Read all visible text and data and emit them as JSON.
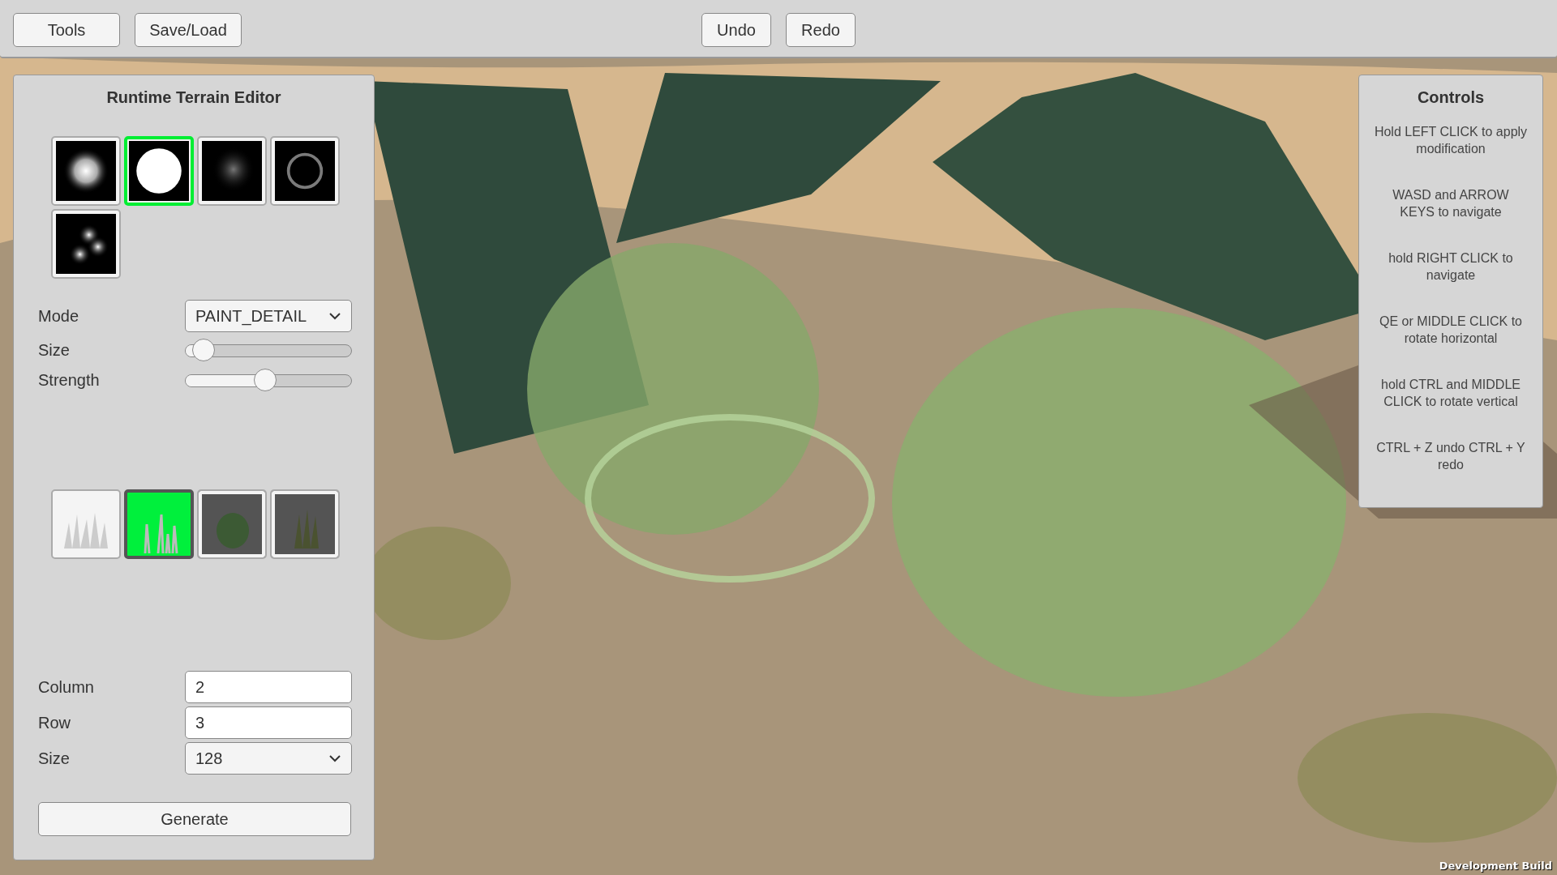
{
  "toolbar": {
    "left_buttons": [
      "Tools",
      "Save/Load"
    ],
    "center_buttons": [
      "Undo",
      "Redo"
    ]
  },
  "editor": {
    "title": "Runtime Terrain Editor",
    "brushes": [
      {
        "kind": "cloud",
        "selected": false
      },
      {
        "kind": "disc",
        "selected": true
      },
      {
        "kind": "smudge",
        "selected": false
      },
      {
        "kind": "ring",
        "selected": false
      },
      {
        "kind": "cluster",
        "selected": false
      }
    ],
    "mode": {
      "label": "Mode",
      "value": "PAINT_DETAIL"
    },
    "sliders": [
      {
        "label": "Size",
        "level": 0.11
      },
      {
        "label": "Strength",
        "level": 0.48
      }
    ],
    "details": [
      {
        "kind": "pale",
        "selected": false
      },
      {
        "kind": "grass",
        "selected": true
      },
      {
        "kind": "bush",
        "selected": false
      },
      {
        "kind": "reeds",
        "selected": false
      }
    ],
    "column": {
      "label": "Column",
      "value": "2"
    },
    "row": {
      "label": "Row",
      "value": "3"
    },
    "size": {
      "label": "Size",
      "value": "128"
    },
    "generate": "Generate"
  },
  "controls": {
    "title": "Controls",
    "items": [
      "Hold LEFT CLICK to apply modification",
      "WASD and ARROW KEYS to navigate",
      "hold RIGHT CLICK to navigate",
      "QE or MIDDLE CLICK to rotate horizontal",
      "hold CTRL and MIDDLE CLICK to rotate vertical",
      "CTRL + Z undo CTRL + Y redo"
    ]
  },
  "build_label": "Development Build"
}
